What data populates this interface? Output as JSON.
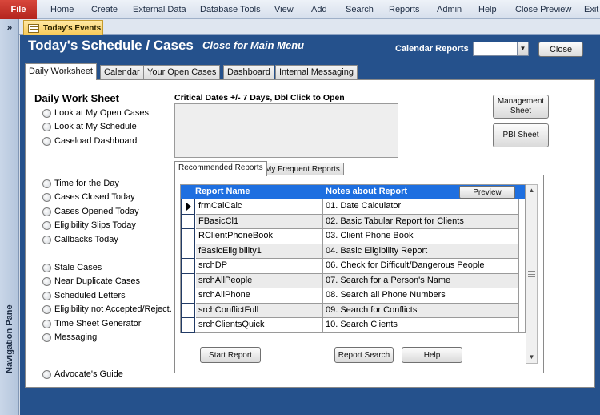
{
  "ribbon": {
    "file_label": "File",
    "menu": [
      "Home",
      "Create",
      "External Data",
      "Database Tools",
      "View",
      "Add",
      "Search",
      "Reports",
      "Admin",
      "Help",
      "Close Preview",
      "Exit"
    ]
  },
  "doc_tab": {
    "label": "Today's Events"
  },
  "nav_pane": {
    "toggle": "»",
    "label": "Navigation Pane"
  },
  "header": {
    "title": "Today's Schedule / Cases",
    "subtitle": "Close for Main Menu",
    "calendar_reports_label": "Calendar Reports",
    "calendar_reports_value": "",
    "close_label": "Close"
  },
  "tabs": [
    "Daily Worksheet",
    "Calendar",
    "Your Open Cases",
    "Dashboard",
    "Internal Messaging"
  ],
  "worksheet": {
    "title": "Daily Work Sheet",
    "options": [
      "Look at My Open Cases",
      "Look at My Schedule",
      "Caseload Dashboard",
      "Time for the Day",
      "Cases Closed Today",
      "Cases Opened Today",
      "Eligibility Slips Today",
      "Callbacks Today",
      "Stale Cases",
      "Near Duplicate Cases",
      "Scheduled Letters",
      "Eligibility not Accepted/Reject.",
      "Time Sheet Generator",
      "Messaging",
      "Advocate's Guide"
    ]
  },
  "critical_dates": {
    "label": "Critical Dates +/- 7 Days, Dbl Click to Open"
  },
  "side_buttons": {
    "management": "Management Sheet",
    "pbi": "PBI Sheet"
  },
  "reports": {
    "tabs": [
      "Recommended Reports",
      "My Frequent Reports"
    ],
    "columns": [
      "Report Name",
      "Notes about Report"
    ],
    "preview_label": "Preview",
    "rows": [
      [
        "frmCalCalc",
        "01. Date Calculator"
      ],
      [
        "FBasicCl1",
        "02. Basic Tabular Report for Clients"
      ],
      [
        "RClientPhoneBook",
        "03. Client Phone Book"
      ],
      [
        "fBasicEligibility1",
        "04. Basic Eligibility Report"
      ],
      [
        "srchDP",
        "06. Check for Difficult/Dangerous People"
      ],
      [
        "srchAllPeople",
        "07. Search for a Person's Name"
      ],
      [
        "srchAllPhone",
        "08. Search all Phone Numbers"
      ],
      [
        "srchConflictFull",
        "09. Search for Conflicts"
      ],
      [
        "srchClientsQuick",
        "10. Search Clients"
      ]
    ],
    "start_label": "Start Report",
    "search_label": "Report Search",
    "help_label": "Help"
  }
}
